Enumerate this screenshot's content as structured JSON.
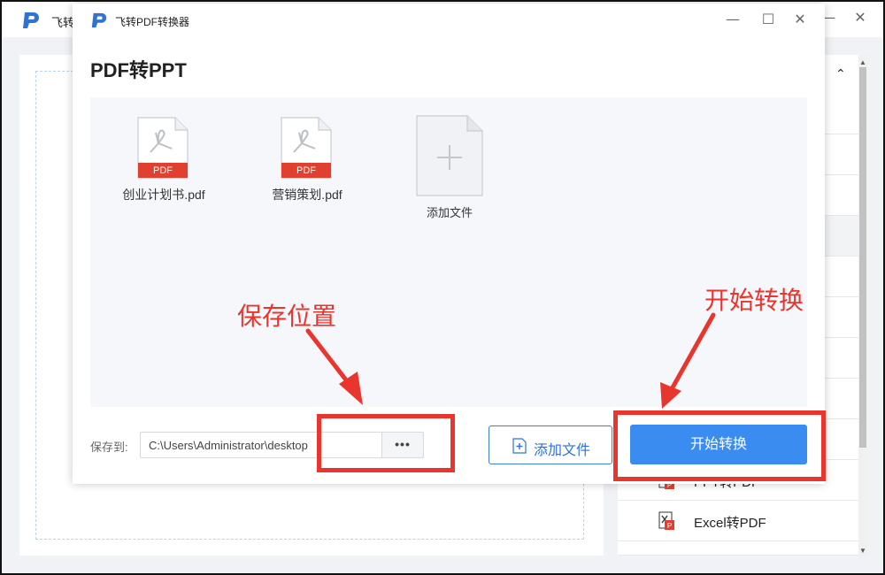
{
  "main_window": {
    "title": "飞转",
    "controls": {
      "minimize": "—",
      "close": "✕"
    },
    "sidebar_items": [
      {
        "label": "PPT转PDF"
      },
      {
        "label": "Excel转PDF"
      }
    ],
    "sidebar_chevron": "⌃"
  },
  "dialog": {
    "title": "飞转PDF转换器",
    "controls": {
      "minimize": "—",
      "maximize": "☐",
      "close": "✕"
    },
    "heading": "PDF转PPT",
    "files": [
      {
        "name": "创业计划书.pdf",
        "badge": "PDF"
      },
      {
        "name": "营销策划.pdf",
        "badge": "PDF"
      }
    ],
    "add_tile_label": "添加文件",
    "save_label": "保存到:",
    "save_path": "C:\\Users\\Administrator\\desktop",
    "browse_label": "•••",
    "add_file_button": "添加文件",
    "start_button": "开始转换"
  },
  "annotations": {
    "save_location": "保存位置",
    "start_conversion": "开始转换"
  },
  "colors": {
    "accent": "#3a8cf0",
    "annotation": "#e8362f",
    "pdf_red": "#e0402f",
    "logo_blue": "#2f73d4"
  }
}
